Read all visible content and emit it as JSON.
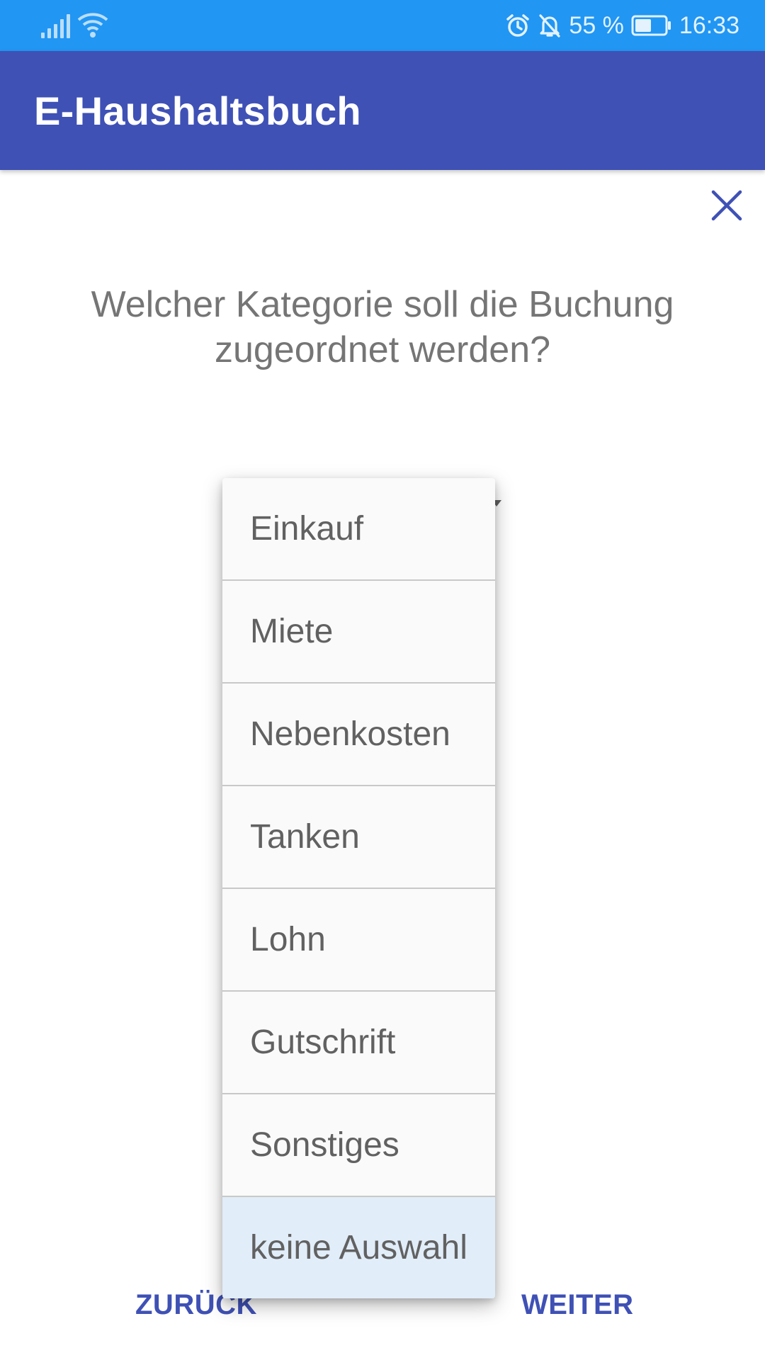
{
  "status_bar": {
    "battery_percent": "55 %",
    "time": "16:33",
    "icons": [
      "signal-icon",
      "wifi-icon",
      "alarm-icon",
      "notifications-off-icon",
      "battery-icon"
    ],
    "battery_level": 0.55
  },
  "app_bar": {
    "title": "E-Haushaltsbuch"
  },
  "dialog": {
    "close_icon": "close-icon",
    "question": "Welcher Kategorie soll die Buchung zugeordnet werden?"
  },
  "category_dropdown": {
    "selected": "keine Auswahl",
    "options": [
      "Einkauf",
      "Miete",
      "Nebenkosten",
      "Tanken",
      "Lohn",
      "Gutschrift",
      "Sonstiges",
      "keine Auswahl"
    ]
  },
  "navigation": {
    "back_label": "ZURÜCK",
    "next_label": "WEITER"
  },
  "colors": {
    "status_bar": "#2196f3",
    "app_bar": "#3f51b5",
    "accent": "#3f51b5",
    "selected_item": "#e1edf9"
  }
}
